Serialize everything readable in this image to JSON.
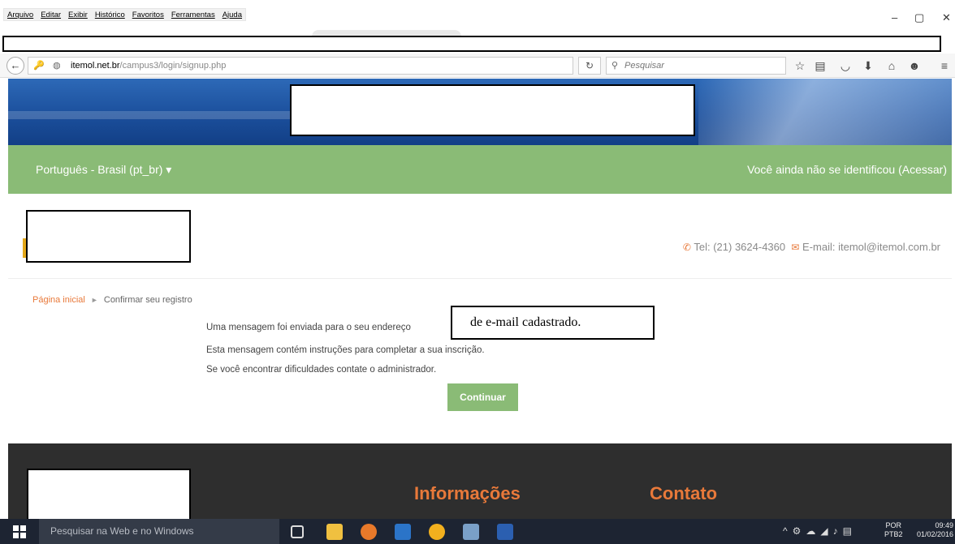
{
  "browser": {
    "menu": [
      "Arquivo",
      "Editar",
      "Exibir",
      "Histórico",
      "Favoritos",
      "Ferramentas",
      "Ajuda"
    ],
    "window_controls": [
      "–",
      "▢",
      "✕"
    ],
    "url_host": "itemol.net.br",
    "url_path": "/campus3/login/signup.php",
    "search_placeholder": "Pesquisar",
    "toolbar_icons": [
      "star-icon",
      "reading-list-icon",
      "pocket-icon",
      "download-icon",
      "home-icon",
      "chat-icon",
      "menu-icon"
    ]
  },
  "site": {
    "language_selector": "Português - Brasil (pt_br) ▾",
    "login_status": "Você ainda não se identificou (Acessar)",
    "contact_tel": "Tel: (21) 3624-4360",
    "contact_email": "E-mail: itemol@itemol.com.br"
  },
  "breadcrumb": {
    "home": "Página inicial",
    "separator": "►",
    "current": "Confirmar seu registro"
  },
  "main": {
    "message_line1": "Uma mensagem foi enviada para o seu endereço",
    "message_line1_overlay": "de e-mail cadastrado.",
    "message_line2": "Esta mensagem contém instruções para completar a sua inscrição.",
    "message_line3": "Se você encontrar dificuldades contate o administrador.",
    "continue_label": "Continuar"
  },
  "footer": {
    "info_heading": "Informações",
    "contact_heading": "Contato"
  },
  "taskbar": {
    "search_placeholder": "Pesquisar na Web e no Windows",
    "language": "POR",
    "keyboard": "PTB2",
    "time": "09:49",
    "date": "01/02/2016"
  },
  "colors": {
    "green": "#8abb76",
    "orange": "#e8793a",
    "footer_bg": "#2e2e2e",
    "taskbar_bg": "#1d2432"
  }
}
